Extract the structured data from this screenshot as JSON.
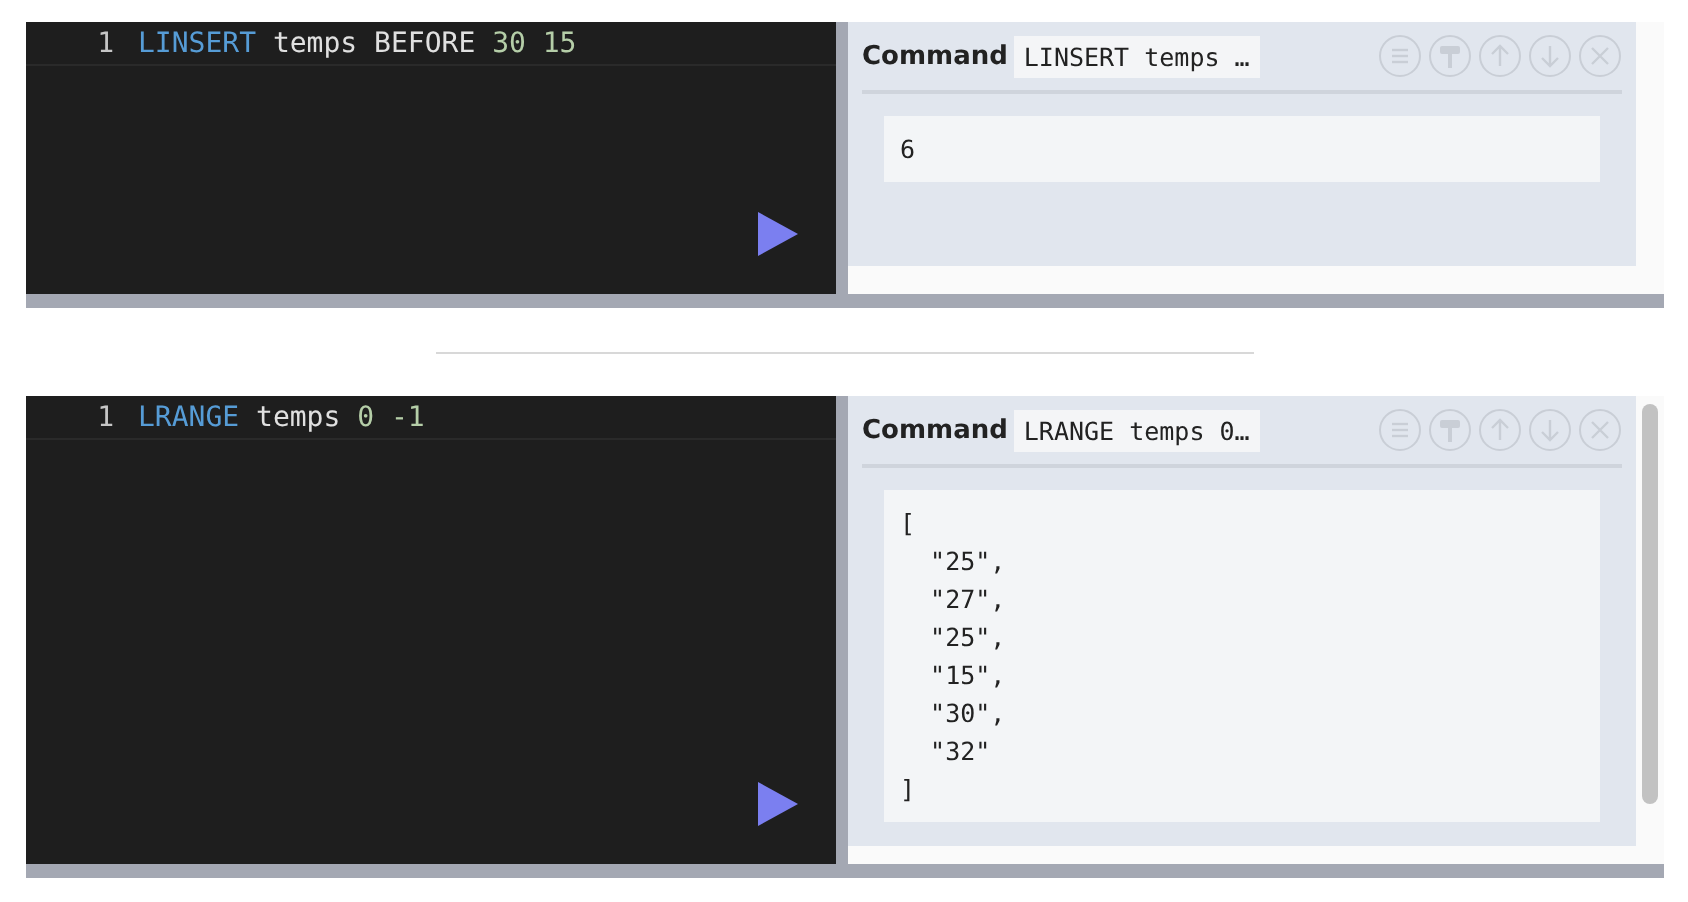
{
  "cells": [
    {
      "line_number": "1",
      "tokens": [
        {
          "text": "LINSERT",
          "kind": "keyword"
        },
        {
          "text": "temps",
          "kind": "plain"
        },
        {
          "text": "BEFORE",
          "kind": "plain"
        },
        {
          "text": "30",
          "kind": "number"
        },
        {
          "text": "15",
          "kind": "number"
        }
      ],
      "result": {
        "label": "Command",
        "command": "LINSERT temps …",
        "output": [
          "6"
        ]
      },
      "scrollbar": false
    },
    {
      "line_number": "1",
      "tokens": [
        {
          "text": "LRANGE",
          "kind": "keyword"
        },
        {
          "text": "temps",
          "kind": "plain"
        },
        {
          "text": "0",
          "kind": "number"
        },
        {
          "text": "-1",
          "kind": "number"
        }
      ],
      "result": {
        "label": "Command",
        "command": "LRANGE temps 0…",
        "output": [
          "[",
          "  \"25\",",
          "  \"27\",",
          "  \"25\",",
          "  \"15\",",
          "  \"30\",",
          "  \"32\"",
          "]"
        ]
      },
      "scrollbar": true
    }
  ]
}
